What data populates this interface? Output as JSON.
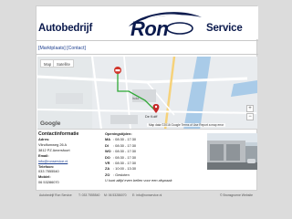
{
  "header": {
    "logo_left": "Autobedrijf",
    "logo_brand": "Ron",
    "logo_right": "Service"
  },
  "menu": {
    "open_bracket": "[",
    "item1": "Marktplaats",
    "separator": "] [",
    "item2": "Contact",
    "close_bracket": "]"
  },
  "map": {
    "tab_map": "Map",
    "tab_satellite": "Satellite",
    "place_label": "De Kolff",
    "street_label": "Isola",
    "google_logo": "Google",
    "zoom_in": "+",
    "zoom_out": "−",
    "footer_text": "Map data ©2016 Google    Terms of Use    Report a map error"
  },
  "contact": {
    "title": "Contactinformatie",
    "address_label": "Adres:",
    "street": "Vlindfumweg 26 A",
    "city": "3812 PZ Amersfoort",
    "email_label": "Email:",
    "email": "info@ronservice.nl",
    "phone_label": "Telefoon:",
    "phone": "033 7555540",
    "mobile_label": "Mobiel:",
    "mobile": "06 53286070"
  },
  "hours": {
    "title": "Openingstijden:",
    "rows": [
      {
        "day": "MA",
        "time": ": 08:30 - 17:30"
      },
      {
        "day": "DI",
        "time": ": 08:30 - 17:30"
      },
      {
        "day": "WO",
        "time": ": 08:30 - 17:30"
      },
      {
        "day": "DO",
        "time": ": 08:30 - 17:30"
      },
      {
        "day": "VR",
        "time": ": 08:30 - 17:30"
      },
      {
        "day": "ZA",
        "time": ": 10:00 - 13:30"
      },
      {
        "day": "ZO",
        "time": ": Gesloten"
      }
    ],
    "note": "U kunt altijd even bellen voor een afspraak"
  },
  "footer": {
    "brand": "Autobedrijf Ron Service",
    "phone": "T: 033 7555540",
    "mobile": "M: 06 53286070",
    "email": "E: info@ronservice.nl",
    "credit": "© Bronsgroene Website"
  },
  "colors": {
    "brand": "#0b1a4d",
    "link": "#1d3f8f",
    "route": "#2fa836",
    "marker": "#d1352b"
  }
}
